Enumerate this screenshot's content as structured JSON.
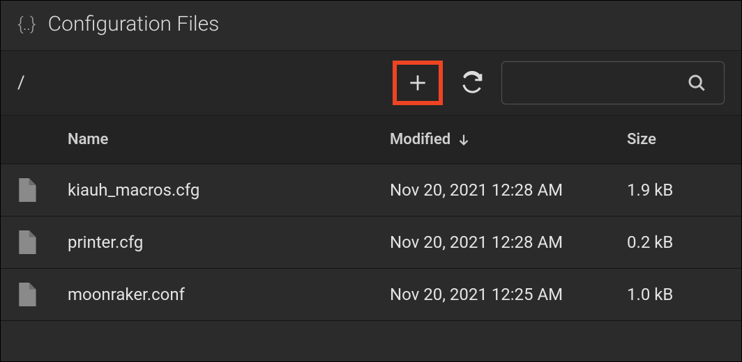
{
  "header": {
    "title": "Configuration Files"
  },
  "toolbar": {
    "path": "/",
    "search_placeholder": ""
  },
  "columns": {
    "name": "Name",
    "modified": "Modified",
    "size": "Size"
  },
  "rows": [
    {
      "name": "kiauh_macros.cfg",
      "modified": "Nov 20, 2021 12:28 AM",
      "size": "1.9 kB",
      "highlight": false
    },
    {
      "name": "printer.cfg",
      "modified": "Nov 20, 2021 12:28 AM",
      "size": "0.2 kB",
      "highlight": true
    },
    {
      "name": "moonraker.conf",
      "modified": "Nov 20, 2021 12:25 AM",
      "size": "1.0 kB",
      "highlight": false
    }
  ]
}
